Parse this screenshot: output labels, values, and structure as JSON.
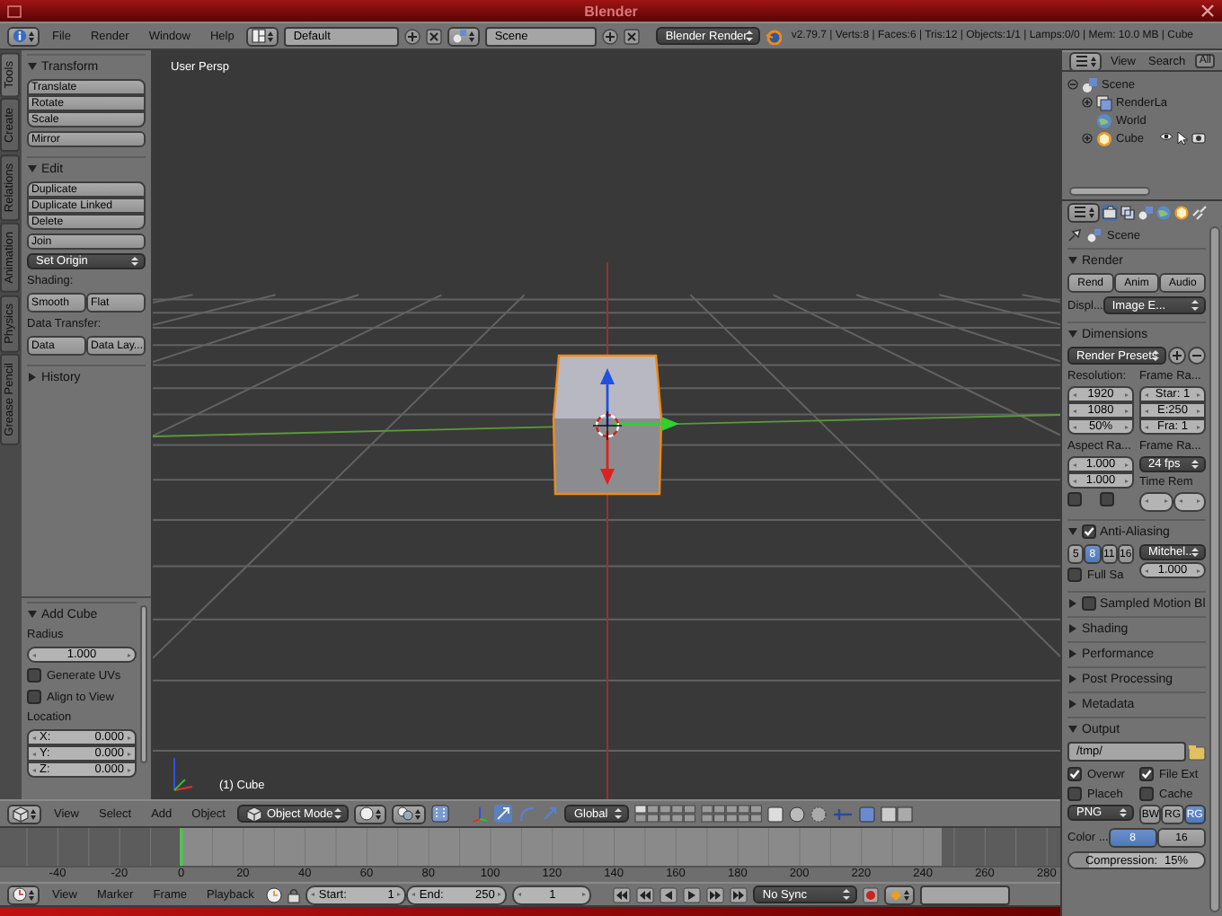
{
  "window": {
    "title": "Blender"
  },
  "info_header": {
    "menus": [
      "File",
      "Render",
      "Window",
      "Help"
    ],
    "screen_layout": "Default",
    "scene": "Scene",
    "render_engine": "Blender Render",
    "statistics": "v2.79.7 | Verts:8 | Faces:6 | Tris:12 | Objects:1/1 | Lamps:0/0 | Mem: 10.0 MB | Cube"
  },
  "tool_shelf": {
    "tabs": [
      {
        "label": "Tools",
        "selected": true
      },
      {
        "label": "Create",
        "selected": false
      },
      {
        "label": "Relations",
        "selected": false
      },
      {
        "label": "Animation",
        "selected": false
      },
      {
        "label": "Physics",
        "selected": false
      },
      {
        "label": "Grease Pencil",
        "selected": false
      }
    ],
    "panels": [
      {
        "title": "Transform",
        "expanded": true,
        "rows": [
          {
            "kind": "stack",
            "items": [
              {
                "kind": "button",
                "label": "Translate"
              },
              {
                "kind": "button",
                "label": "Rotate"
              },
              {
                "kind": "button",
                "label": "Scale"
              }
            ]
          },
          {
            "kind": "button",
            "label": "Mirror"
          }
        ]
      },
      {
        "title": "Edit",
        "expanded": true,
        "rows": [
          {
            "kind": "stack",
            "items": [
              {
                "kind": "button",
                "label": "Duplicate"
              },
              {
                "kind": "button",
                "label": "Duplicate Linked"
              },
              {
                "kind": "button",
                "label": "Delete"
              }
            ]
          },
          {
            "kind": "button",
            "label": "Join"
          },
          {
            "kind": "dropdown",
            "value": "Set Origin"
          },
          {
            "kind": "label",
            "text": "Shading:"
          },
          {
            "kind": "row",
            "items": [
              {
                "kind": "button",
                "label": "Smooth"
              },
              {
                "kind": "button",
                "label": "Flat"
              }
            ]
          },
          {
            "kind": "label",
            "text": "Data Transfer:"
          },
          {
            "kind": "row",
            "items": [
              {
                "kind": "button",
                "label": "Data"
              },
              {
                "kind": "button",
                "label": "Data Lay..."
              }
            ]
          }
        ]
      },
      {
        "title": "History",
        "expanded": false
      }
    ]
  },
  "operator_panel": {
    "title": "Add Cube",
    "expanded": true,
    "rows": [
      {
        "kind": "label",
        "text": "Radius"
      },
      {
        "kind": "number",
        "value": "1.000"
      },
      {
        "kind": "check",
        "label": "Generate UVs",
        "checked": false
      },
      {
        "kind": "check",
        "label": "Align to View",
        "checked": false
      },
      {
        "kind": "label",
        "text": "Location"
      },
      {
        "kind": "stack",
        "items": [
          {
            "kind": "number",
            "label": "X:",
            "value": "0.000"
          },
          {
            "kind": "number",
            "label": "Y:",
            "value": "0.000"
          },
          {
            "kind": "number",
            "label": "Z:",
            "value": "0.000"
          }
        ]
      }
    ]
  },
  "viewport": {
    "view_label": "User Persp",
    "object_label": "(1) Cube"
  },
  "viewport_header": {
    "menus": [
      "View",
      "Select",
      "Add",
      "Object"
    ],
    "mode": "Object Mode",
    "orientation": "Global"
  },
  "timeline": {
    "ruler": [
      "-40",
      "-20",
      "0",
      "20",
      "40",
      "60",
      "80",
      "100",
      "120",
      "140",
      "160",
      "180",
      "200",
      "220",
      "240",
      "260",
      "280"
    ]
  },
  "timeline_header": {
    "menus": [
      "View",
      "Marker",
      "Frame",
      "Playback"
    ],
    "start": {
      "label": "Start:",
      "value": "1"
    },
    "end": {
      "label": "End:",
      "value": "250"
    },
    "current_frame": "1",
    "sync": "No Sync"
  },
  "outliner": {
    "menus": [
      "View",
      "Search"
    ],
    "filter": "All",
    "tree": [
      {
        "kind": "scene",
        "label": "Scene",
        "expanded": true,
        "children": [
          {
            "kind": "render_layers",
            "label": "RenderLa",
            "expanded": false
          },
          {
            "kind": "world",
            "label": "World"
          },
          {
            "kind": "object",
            "label": "Cube",
            "expanded": false
          }
        ]
      }
    ]
  },
  "properties": {
    "context_tabs": [
      {
        "selected": true
      },
      {
        "selected": false
      },
      {
        "selected": false
      },
      {
        "selected": false
      },
      {
        "selected": false
      },
      {
        "selected": false
      }
    ],
    "breadcrumb": "Scene",
    "panels": [
      {
        "title": "Render",
        "expanded": true,
        "rows": [
          {
            "kind": "row",
            "items": [
              {
                "kind": "button",
                "label": "Rend"
              },
              {
                "kind": "button",
                "label": "Anim"
              },
              {
                "kind": "button",
                "label": "Audio"
              }
            ]
          },
          {
            "kind": "row",
            "items": [
              {
                "kind": "label",
                "text": "Displ..."
              },
              {
                "kind": "dropdown",
                "value": "Image E..."
              }
            ]
          }
        ]
      },
      {
        "title": "Dimensions",
        "expanded": true,
        "rows": [
          {
            "kind": "preset",
            "value": "Render Presets"
          },
          {
            "kind": "columns",
            "columns": [
              [
                {
                  "kind": "label",
                  "text": "Resolution:"
                },
                {
                  "kind": "stack",
                  "items": [
                    {
                      "kind": "number",
                      "value": "1920"
                    },
                    {
                      "kind": "number",
                      "value": "1080"
                    },
                    {
                      "kind": "number",
                      "value": "50%"
                    }
                  ]
                }
              ],
              [
                {
                  "kind": "label",
                  "text": "Frame Ra..."
                },
                {
                  "kind": "stack",
                  "items": [
                    {
                      "kind": "number",
                      "value": "Star: 1"
                    },
                    {
                      "kind": "number",
                      "value": "E:250"
                    },
                    {
                      "kind": "number",
                      "value": "Fra: 1"
                    }
                  ]
                }
              ]
            ]
          },
          {
            "kind": "columns",
            "columns": [
              [
                {
                  "kind": "label",
                  "text": "Aspect Ra..."
                },
                {
                  "kind": "stack",
                  "items": [
                    {
                      "kind": "number",
                      "value": "1.000"
                    },
                    {
                      "kind": "number",
                      "value": "1.000"
                    }
                  ]
                },
                {
                  "kind": "row",
                  "items": [
                    {
                      "kind": "check",
                      "checked": false
                    },
                    {
                      "kind": "check",
                      "checked": false
                    }
                  ]
                }
              ],
              [
                {
                  "kind": "label",
                  "text": "Frame Ra..."
                },
                {
                  "kind": "dropdown",
                  "value": "24 fps"
                },
                {
                  "kind": "label",
                  "text": "Time Rem"
                },
                {
                  "kind": "row",
                  "items": [
                    {
                      "kind": "number"
                    },
                    {
                      "kind": "number"
                    }
                  ]
                }
              ]
            ]
          }
        ]
      },
      {
        "title": "Anti-Aliasing",
        "expanded": true,
        "checked": true,
        "rows": [
          {
            "kind": "columns",
            "columns": [
              [
                {
                  "kind": "row",
                  "items": [
                    {
                      "kind": "button",
                      "label": "5",
                      "selected": false
                    },
                    {
                      "kind": "button",
                      "label": "8",
                      "selected": true
                    },
                    {
                      "kind": "button",
                      "label": "11",
                      "selected": false
                    },
                    {
                      "kind": "button",
                      "label": "16",
                      "selected": false
                    }
                  ]
                },
                {
                  "kind": "check",
                  "label": "Full Sa",
                  "checked": false
                }
              ],
              [
                {
                  "kind": "dropdown",
                  "value": "Mitchel.."
                },
                {
                  "kind": "number",
                  "value": "1.000"
                }
              ]
            ]
          }
        ]
      },
      {
        "title": "Sampled Motion Bl",
        "expanded": false,
        "checked": false
      },
      {
        "title": "Shading",
        "expanded": false
      },
      {
        "title": "Performance",
        "expanded": false
      },
      {
        "title": "Post Processing",
        "expanded": false
      },
      {
        "title": "Metadata",
        "expanded": false
      },
      {
        "title": "Output",
        "expanded": true,
        "rows": [
          {
            "kind": "path",
            "value": "/tmp/"
          },
          {
            "kind": "columns",
            "columns": [
              [
                {
                  "kind": "check",
                  "label": "Overwr",
                  "checked": true
                },
                {
                  "kind": "check",
                  "label": "Placeh",
                  "checked": false
                },
                {
                  "kind": "dropdown",
                  "value": "PNG"
                }
              ],
              [
                {
                  "kind": "check",
                  "label": "File Ext",
                  "checked": true
                },
                {
                  "kind": "check",
                  "label": "Cache",
                  "checked": false
                },
                {
                  "kind": "row",
                  "items": [
                    {
                      "kind": "button",
                      "label": "BW",
                      "selected": false
                    },
                    {
                      "kind": "button",
                      "label": "RG",
                      "selected": false
                    },
                    {
                      "kind": "button",
                      "label": "RG",
                      "selected": true
                    }
                  ]
                }
              ]
            ]
          },
          {
            "kind": "row",
            "items": [
              {
                "kind": "label",
                "text": "Color ..."
              },
              {
                "kind": "button",
                "label": "8",
                "selected": true
              },
              {
                "kind": "button",
                "label": "16",
                "selected": false
              }
            ]
          },
          {
            "kind": "slider",
            "label": "Compression:",
            "value": "15%",
            "level": 0.15
          }
        ]
      }
    ]
  }
}
